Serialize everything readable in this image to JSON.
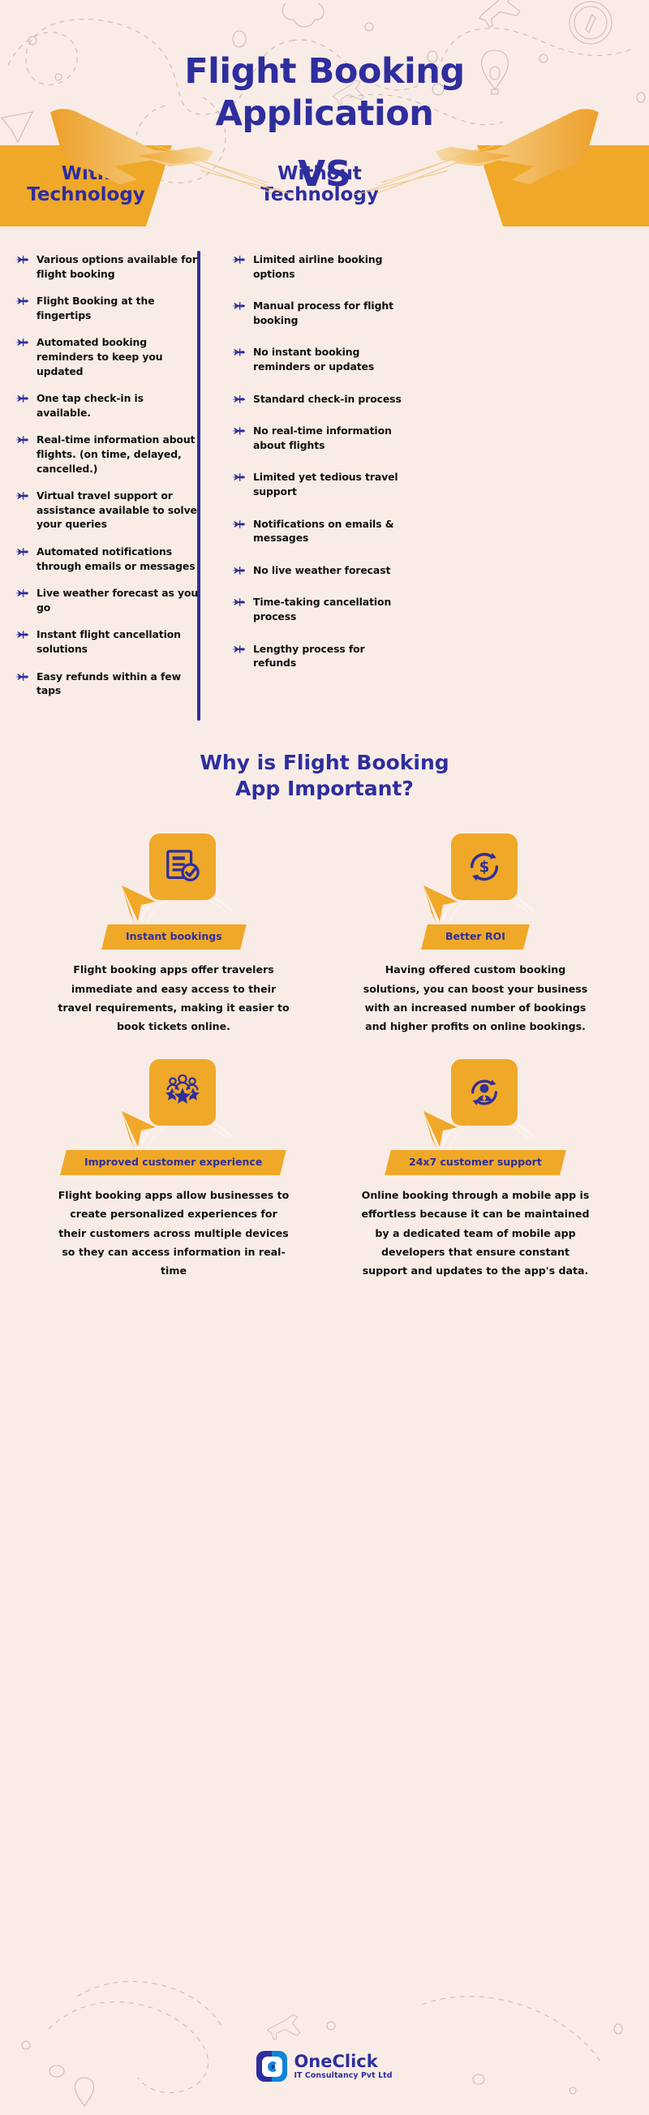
{
  "theme": {
    "background": "#f9ece6",
    "accent_blue": "#2e2e9e",
    "accent_orange": "#f0a828",
    "text_dark": "#111111"
  },
  "header": {
    "title_line1": "Flight Booking",
    "title_line2": "Application"
  },
  "vs_band": {
    "left_line1": "With",
    "left_line2": "Technology",
    "vs": "VS",
    "right_line1": "Without",
    "right_line2": "Technology"
  },
  "comparison": {
    "with_technology": [
      "Various options available for flight booking",
      "Flight Booking at the fingertips",
      "Automated booking reminders to keep you updated",
      "One tap check-in is available.",
      "Real-time information about flights. (on time, delayed, cancelled.)",
      "Virtual travel support or assistance available to solve your queries",
      "Automated notifications through emails or messages",
      "Live weather forecast as you go",
      "Instant flight cancellation solutions",
      "Easy refunds within a few taps"
    ],
    "without_technology": [
      "Limited airline booking options",
      "Manual process for flight booking",
      "No instant booking reminders or updates",
      "Standard check-in process",
      "No real-time information about flights",
      "Limited yet tedious travel support",
      "Notifications on emails & messages",
      "No live weather forecast",
      "Time-taking cancellation process",
      "Lengthy process for refunds"
    ]
  },
  "why_section": {
    "title_line1": "Why is Flight Booking",
    "title_line2": "App Important?",
    "cards": [
      {
        "icon": "document-check-icon",
        "label": "Instant bookings",
        "body": "Flight booking apps offer travelers immediate and easy access to their travel requirements, making it easier to book tickets online."
      },
      {
        "icon": "dollar-refresh-icon",
        "label": "Better ROI",
        "body": "Having offered custom booking solutions, you can boost your business with an increased number of bookings and higher profits on online bookings."
      },
      {
        "icon": "people-stars-icon",
        "label": "Improved customer experience",
        "body": "Flight booking apps allow businesses to create personalized experiences for their customers across multiple devices so they can access information in real-time"
      },
      {
        "icon": "support-person-icon",
        "label": "24x7 customer support",
        "body": "Online booking through a mobile app is effortless because it can be maintained by a dedicated team of mobile app developers that ensure constant support and updates to the app's data."
      }
    ]
  },
  "footer": {
    "brand_name": "OneClick",
    "brand_tagline": "IT Consultancy Pvt Ltd"
  }
}
